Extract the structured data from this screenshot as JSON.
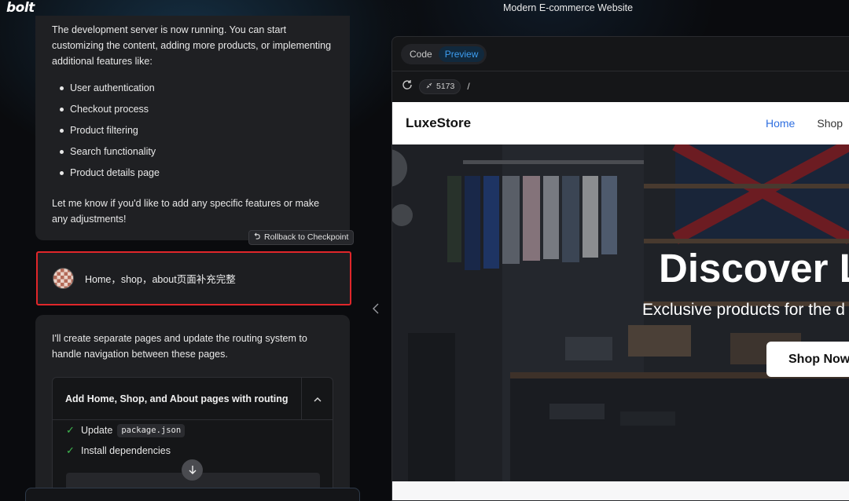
{
  "app": {
    "logo": "bolt",
    "window_title": "Modern E-commerce Website"
  },
  "chat": {
    "assistant_intro": "The development server is now running. You can start customizing the content, adding more products, or implementing additional features like:",
    "features": [
      "User authentication",
      "Checkout process",
      "Product filtering",
      "Search functionality",
      "Product details page"
    ],
    "assistant_outro": "Let me know if you'd like to add any specific features or make any adjustments!",
    "rollback_label": "Rollback to Checkpoint",
    "user_message": "Home，shop，about页面补充完整",
    "reply_text": "I'll create separate pages and update the routing system to handle navigation between these pages.",
    "artifact": {
      "title": "Add Home, Shop, and About pages with routing",
      "steps": [
        {
          "label": "Update",
          "code": "package.json"
        },
        {
          "label": "Install dependencies",
          "code": ""
        }
      ]
    }
  },
  "workbench": {
    "tabs": [
      "Code",
      "Preview"
    ],
    "active_tab": "Preview",
    "port": "5173",
    "path": "/",
    "site": {
      "brand": "LuxeStore",
      "nav": [
        "Home",
        "Shop"
      ],
      "hero_title": "Discover L",
      "hero_subtitle": "Exclusive products for the d",
      "cta": "Shop Now"
    }
  },
  "colors": {
    "accent": "#3d9df0",
    "highlight_border": "#e0262a",
    "check": "#3fb950",
    "nav_active": "#2f6fe0"
  }
}
